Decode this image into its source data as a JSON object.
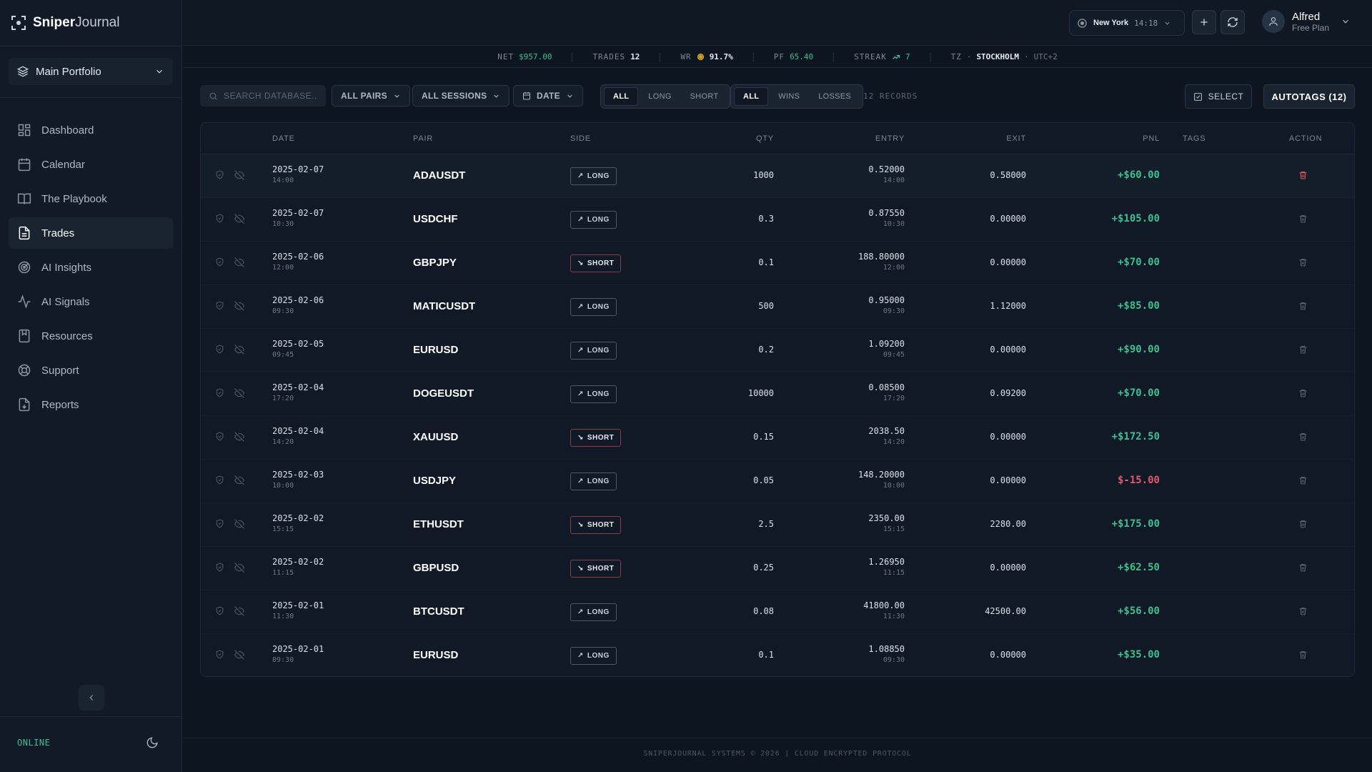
{
  "app": {
    "logo_bold": "Sniper",
    "logo_light": "Journal"
  },
  "sidebar": {
    "portfolio": "Main Portfolio",
    "items": [
      {
        "label": "Dashboard",
        "icon": "dashboard-icon"
      },
      {
        "label": "Calendar",
        "icon": "calendar-icon"
      },
      {
        "label": "The Playbook",
        "icon": "book-icon"
      },
      {
        "label": "Trades",
        "icon": "document-icon",
        "active": true
      },
      {
        "label": "AI Insights",
        "icon": "radar-icon"
      },
      {
        "label": "AI Signals",
        "icon": "activity-icon"
      },
      {
        "label": "Resources",
        "icon": "bookmark-book-icon"
      },
      {
        "label": "Support",
        "icon": "lifebuoy-icon"
      },
      {
        "label": "Reports",
        "icon": "report-icon"
      }
    ],
    "status": "ONLINE"
  },
  "header": {
    "city": "New York",
    "time": "14:18",
    "user_name": "Alfred",
    "user_plan": "Free Plan"
  },
  "stats": {
    "net_label": "NET",
    "net_value": "$957.00",
    "trades_label": "TRADES",
    "trades_value": "12",
    "wr_label": "WR",
    "wr_value": "91.7%",
    "pf_label": "PF",
    "pf_value": "65.40",
    "streak_label": "STREAK",
    "streak_value": "7",
    "tz_label": "TZ",
    "tz_sep": "·",
    "tz_city": "STOCKHOLM",
    "tz_offset": "UTC+2"
  },
  "toolbar": {
    "search_placeholder": "SEARCH DATABASE...",
    "pairs": "ALL PAIRS",
    "sessions": "ALL SESSIONS",
    "date": "DATE",
    "side_filters": [
      "ALL",
      "LONG",
      "SHORT"
    ],
    "outcome_filters": [
      "ALL",
      "WINS",
      "LOSSES"
    ],
    "records": "12 RECORDS",
    "select": "SELECT",
    "autotags": "AUTOTAGS (12)"
  },
  "table": {
    "columns": [
      "DATE",
      "PAIR",
      "SIDE",
      "QTY",
      "ENTRY",
      "EXIT",
      "PNL",
      "TAGS",
      "ACTION"
    ],
    "rows": [
      {
        "date": "2025-02-07",
        "time": "14:00",
        "pair": "ADAUSDT",
        "side": "LONG",
        "qty": "1000",
        "entry": "0.52000",
        "entry_time": "14:00",
        "exit": "0.58000",
        "pnl": "+$60.00",
        "positive": true
      },
      {
        "date": "2025-02-07",
        "time": "10:30",
        "pair": "USDCHF",
        "side": "LONG",
        "qty": "0.3",
        "entry": "0.87550",
        "entry_time": "10:30",
        "exit": "0.00000",
        "pnl": "+$105.00",
        "positive": true
      },
      {
        "date": "2025-02-06",
        "time": "12:00",
        "pair": "GBPJPY",
        "side": "SHORT",
        "qty": "0.1",
        "entry": "188.80000",
        "entry_time": "12:00",
        "exit": "0.00000",
        "pnl": "+$70.00",
        "positive": true
      },
      {
        "date": "2025-02-06",
        "time": "09:30",
        "pair": "MATICUSDT",
        "side": "LONG",
        "qty": "500",
        "entry": "0.95000",
        "entry_time": "09:30",
        "exit": "1.12000",
        "pnl": "+$85.00",
        "positive": true
      },
      {
        "date": "2025-02-05",
        "time": "09:45",
        "pair": "EURUSD",
        "side": "LONG",
        "qty": "0.2",
        "entry": "1.09200",
        "entry_time": "09:45",
        "exit": "0.00000",
        "pnl": "+$90.00",
        "positive": true
      },
      {
        "date": "2025-02-04",
        "time": "17:20",
        "pair": "DOGEUSDT",
        "side": "LONG",
        "qty": "10000",
        "entry": "0.08500",
        "entry_time": "17:20",
        "exit": "0.09200",
        "pnl": "+$70.00",
        "positive": true
      },
      {
        "date": "2025-02-04",
        "time": "14:20",
        "pair": "XAUUSD",
        "side": "SHORT",
        "qty": "0.15",
        "entry": "2038.50",
        "entry_time": "14:20",
        "exit": "0.00000",
        "pnl": "+$172.50",
        "positive": true
      },
      {
        "date": "2025-02-03",
        "time": "10:00",
        "pair": "USDJPY",
        "side": "LONG",
        "qty": "0.05",
        "entry": "148.20000",
        "entry_time": "10:00",
        "exit": "0.00000",
        "pnl": "$-15.00",
        "positive": false
      },
      {
        "date": "2025-02-02",
        "time": "15:15",
        "pair": "ETHUSDT",
        "side": "SHORT",
        "qty": "2.5",
        "entry": "2350.00",
        "entry_time": "15:15",
        "exit": "2280.00",
        "pnl": "+$175.00",
        "positive": true
      },
      {
        "date": "2025-02-02",
        "time": "11:15",
        "pair": "GBPUSD",
        "side": "SHORT",
        "qty": "0.25",
        "entry": "1.26950",
        "entry_time": "11:15",
        "exit": "0.00000",
        "pnl": "+$62.50",
        "positive": true
      },
      {
        "date": "2025-02-01",
        "time": "11:30",
        "pair": "BTCUSDT",
        "side": "LONG",
        "qty": "0.08",
        "entry": "41800.00",
        "entry_time": "11:30",
        "exit": "42500.00",
        "pnl": "+$56.00",
        "positive": true
      },
      {
        "date": "2025-02-01",
        "time": "09:30",
        "pair": "EURUSD",
        "side": "LONG",
        "qty": "0.1",
        "entry": "1.08850",
        "entry_time": "09:30",
        "exit": "0.00000",
        "pnl": "+$35.00",
        "positive": true
      }
    ]
  },
  "footer": "SNIPERJOURNAL SYSTEMS © 2026 | CLOUD ENCRYPTED PROTOCOL",
  "colors": {
    "accent_green": "#3fbf8f",
    "loss_red": "#e35b66",
    "background": "#0d1520",
    "sidebar": "#111a26"
  }
}
